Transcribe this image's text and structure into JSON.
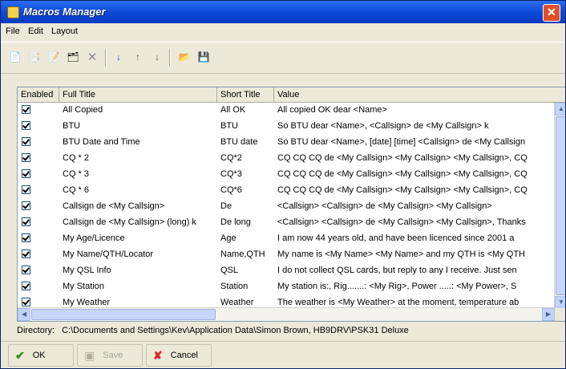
{
  "window": {
    "title": "Macros Manager"
  },
  "menu": [
    "File",
    "Edit",
    "Layout"
  ],
  "toolbar": {
    "icons": [
      "new-macro-icon",
      "copy-macro-icon",
      "edit-macro-icon",
      "properties-icon",
      "delete-icon",
      "sort-az-icon",
      "move-up-icon",
      "move-down-icon",
      "import-icon",
      "export-icon"
    ]
  },
  "table": {
    "columns": [
      "Enabled",
      "Full Title",
      "Short Title",
      "Value"
    ],
    "rows": [
      {
        "enabled": true,
        "full": "All Copied",
        "short": "All OK",
        "value": "All copied OK dear <Name>"
      },
      {
        "enabled": true,
        "full": "BTU",
        "short": "BTU",
        "value": "So BTU dear <Name>, <Callsign> de <My Callsign> k"
      },
      {
        "enabled": true,
        "full": "BTU Date and Time",
        "short": "BTU date",
        "value": "So BTU dear <Name>, [date] [time] <Callsign> de <My Callsign"
      },
      {
        "enabled": true,
        "full": "CQ * 2",
        "short": "CQ*2",
        "value": "CQ CQ CQ de <My Callsign> <My Callsign> <My Callsign>, CQ"
      },
      {
        "enabled": true,
        "full": "CQ * 3",
        "short": "CQ*3",
        "value": "CQ CQ CQ de <My Callsign> <My Callsign> <My Callsign>, CQ"
      },
      {
        "enabled": true,
        "full": "CQ * 6",
        "short": "CQ*6",
        "value": "CQ CQ CQ de <My Callsign> <My Callsign> <My Callsign>, CQ"
      },
      {
        "enabled": true,
        "full": "Callsign de <My Callsign>",
        "short": "De",
        "value": "<Callsign> <Callsign> de <My Callsign> <My Callsign>"
      },
      {
        "enabled": true,
        "full": "Callsign de <My Callsign> (long) k",
        "short": "De long",
        "value": "<Callsign> <Callsign> de <My Callsign> <My Callsign>, Thanks"
      },
      {
        "enabled": true,
        "full": "My Age/Licence",
        "short": "Age",
        "value": "I am now 44 years old, and have been licenced since 2001 a"
      },
      {
        "enabled": true,
        "full": "My Name/QTH/Locator",
        "short": "Name,QTH",
        "value": "My name is <My Name> <My Name> and my QTH is <My QTH"
      },
      {
        "enabled": true,
        "full": "My QSL Info",
        "short": "QSL",
        "value": "I do not collect QSL cards, but reply to any I receive. Just sen"
      },
      {
        "enabled": true,
        "full": "My Station",
        "short": "Station",
        "value": "My station is:, Rig.......: <My Rig>, Power .....: <My Power>, S"
      },
      {
        "enabled": true,
        "full": "My Weather",
        "short": "Weather",
        "value": "The weather is <My Weather> at the moment, temperature ab"
      }
    ]
  },
  "directory": {
    "label": "Directory:",
    "path": "C:\\Documents and Settings\\Kev\\Application Data\\Simon Brown, HB9DRV\\PSK31 Deluxe"
  },
  "footer": {
    "ok": "OK",
    "save": "Save",
    "cancel": "Cancel"
  }
}
